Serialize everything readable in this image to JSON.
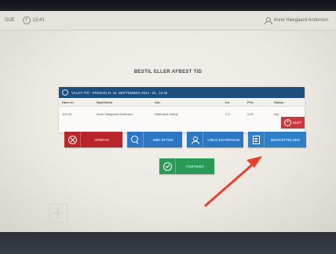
{
  "topbar": {
    "left_text": "DUE",
    "clock_text": "13:41",
    "user_name": "Anne Høegaard Andersen"
  },
  "page_title": "BESTIL ELLER AFBEST TID",
  "panel": {
    "header_text": "VALGT TID - FREDAG D. 15. SEPTEMBER 2014 - KL. 13:45",
    "columns": [
      "Navn nr.",
      "Bydel/sted",
      "Adr.",
      "Int.",
      "Pris",
      "Status"
    ],
    "row": [
      "123 45",
      "Anne Høegaard Andersen",
      "Rådhuset Dalbyt",
      "2,0",
      "0,00",
      "Nej"
    ],
    "delete_label": "SLET"
  },
  "buttons": {
    "cancel": "AFBRYD",
    "search": "SØG EFTER",
    "choose_person": "VÆLG EN PERSON",
    "confirm_list": "BEKRÆFTELSER",
    "ok": "FORTSÆT"
  },
  "colors": {
    "header_blue": "#1c4f7e",
    "button_blue": "#2d77c2",
    "button_red": "#b8262b",
    "button_green": "#2a9b57",
    "arrow_red": "#e8412a"
  },
  "icons": [
    "clock-icon",
    "user-icon",
    "check-circle-icon",
    "close-circle-icon",
    "search-icon",
    "person-icon",
    "document-icon"
  ]
}
